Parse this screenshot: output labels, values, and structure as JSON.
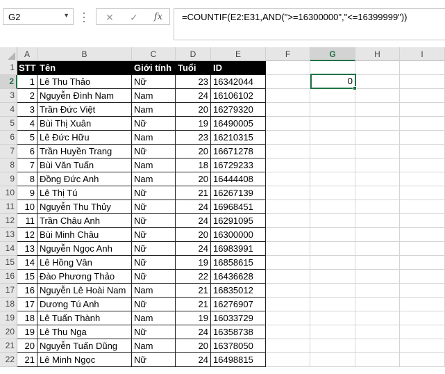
{
  "name_box": {
    "value": "G2"
  },
  "formula_bar": {
    "formula": "=COUNTIF(E2:E31,AND(\">=16300000\",\"<=16399999\"))"
  },
  "icons": {
    "dropdown": "chevron-down-icon",
    "cancel": "close-icon",
    "enter": "check-icon",
    "function": "fx-icon"
  },
  "colors": {
    "accent": "#217346",
    "header_bg": "#000000",
    "header_fg": "#ffffff"
  },
  "columns": [
    "A",
    "B",
    "C",
    "D",
    "E",
    "F",
    "G",
    "H",
    "I"
  ],
  "selected_column": "G",
  "selected_row": "2",
  "header_row": {
    "stt": "STT",
    "ten": "Tên",
    "gioi_tinh": "Giới tính",
    "tuoi": "Tuổi",
    "id": "ID"
  },
  "rows": [
    {
      "n": "2",
      "stt": "1",
      "ten": "Lê Thu Thảo",
      "gt": "Nữ",
      "tuoi": "23",
      "id": "16342044"
    },
    {
      "n": "3",
      "stt": "2",
      "ten": "Nguyễn Đình Nam",
      "gt": "Nam",
      "tuoi": "24",
      "id": "16106102"
    },
    {
      "n": "4",
      "stt": "3",
      "ten": "Trần Đức Việt",
      "gt": "Nam",
      "tuoi": "20",
      "id": "16279320"
    },
    {
      "n": "5",
      "stt": "4",
      "ten": "Bùi Thị Xuân",
      "gt": "Nữ",
      "tuoi": "19",
      "id": "16490005"
    },
    {
      "n": "6",
      "stt": "5",
      "ten": "Lê Đức Hữu",
      "gt": "Nam",
      "tuoi": "23",
      "id": "16210315"
    },
    {
      "n": "7",
      "stt": "6",
      "ten": "Trần Huyền Trang",
      "gt": "Nữ",
      "tuoi": "20",
      "id": "16671278"
    },
    {
      "n": "8",
      "stt": "7",
      "ten": "Bùi Văn Tuấn",
      "gt": "Nam",
      "tuoi": "18",
      "id": "16729233"
    },
    {
      "n": "9",
      "stt": "8",
      "ten": "Đồng Đức Anh",
      "gt": "Nam",
      "tuoi": "20",
      "id": "16444408"
    },
    {
      "n": "10",
      "stt": "9",
      "ten": "Lê Thị Tú",
      "gt": "Nữ",
      "tuoi": "21",
      "id": "16267139"
    },
    {
      "n": "11",
      "stt": "10",
      "ten": "Nguyễn Thu Thủy",
      "gt": "Nữ",
      "tuoi": "24",
      "id": "16968451"
    },
    {
      "n": "12",
      "stt": "11",
      "ten": "Trần Châu Anh",
      "gt": "Nữ",
      "tuoi": "24",
      "id": "16291095"
    },
    {
      "n": "13",
      "stt": "12",
      "ten": "Bùi Minh Châu",
      "gt": "Nữ",
      "tuoi": "20",
      "id": "16300000"
    },
    {
      "n": "14",
      "stt": "13",
      "ten": "Nguyễn Ngọc Anh",
      "gt": "Nữ",
      "tuoi": "24",
      "id": "16983991"
    },
    {
      "n": "15",
      "stt": "14",
      "ten": "Lê Hồng Vân",
      "gt": "Nữ",
      "tuoi": "19",
      "id": "16858615"
    },
    {
      "n": "16",
      "stt": "15",
      "ten": "Đào Phương Thảo",
      "gt": "Nữ",
      "tuoi": "22",
      "id": "16436628"
    },
    {
      "n": "17",
      "stt": "16",
      "ten": "Nguyễn Lê Hoài Nam",
      "gt": "Nam",
      "tuoi": "21",
      "id": "16835012"
    },
    {
      "n": "18",
      "stt": "17",
      "ten": "Dương Tú Anh",
      "gt": "Nữ",
      "tuoi": "21",
      "id": "16276907"
    },
    {
      "n": "19",
      "stt": "18",
      "ten": "Lê Tuấn Thành",
      "gt": "Nam",
      "tuoi": "19",
      "id": "16033729"
    },
    {
      "n": "20",
      "stt": "19",
      "ten": "Lê Thu Nga",
      "gt": "Nữ",
      "tuoi": "24",
      "id": "16358738"
    },
    {
      "n": "21",
      "stt": "20",
      "ten": "Nguyễn Tuấn Dũng",
      "gt": "Nam",
      "tuoi": "20",
      "id": "16378050"
    },
    {
      "n": "22",
      "stt": "21",
      "ten": "Lê Minh Ngọc",
      "gt": "Nữ",
      "tuoi": "24",
      "id": "16498815"
    }
  ],
  "result_cell": {
    "value": "0"
  }
}
